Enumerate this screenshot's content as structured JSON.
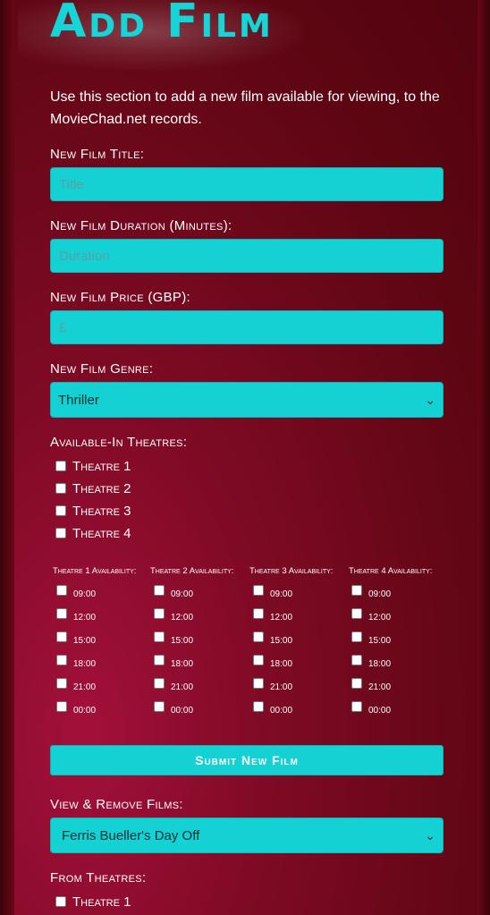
{
  "page": {
    "title": "Add Film",
    "intro": "Use this section to add a new film available for viewing, to the MovieChad.net records."
  },
  "add_form": {
    "title_label": "New Film Title:",
    "title_placeholder": "Title",
    "duration_label": "New Film Duration (Minutes):",
    "duration_placeholder": "Duration",
    "price_label": "New Film Price (GBP):",
    "price_placeholder": "£",
    "genre_label": "New Film Genre:",
    "genre_selected": "Thriller",
    "theatres_label": "Available-In Theatres:",
    "theatres": [
      "Theatre 1",
      "Theatre 2",
      "Theatre 3",
      "Theatre 4"
    ],
    "availability_headers": [
      "Theatre 1 Availability:",
      "Theatre 2 Availability:",
      "Theatre 3 Availability:",
      "Theatre 4 Availability:"
    ],
    "times": [
      "09:00",
      "12:00",
      "15:00",
      "18:00",
      "21:00",
      "00:00"
    ],
    "submit_label": "Submit New Film"
  },
  "remove_form": {
    "label": "View & Remove Films:",
    "selected_film": "Ferris Bueller's Day Off",
    "from_label": "From Theatres:",
    "theatres": [
      "Theatre 1"
    ]
  },
  "colors": {
    "accent": "#14d1d3",
    "background": "#5c0612"
  }
}
